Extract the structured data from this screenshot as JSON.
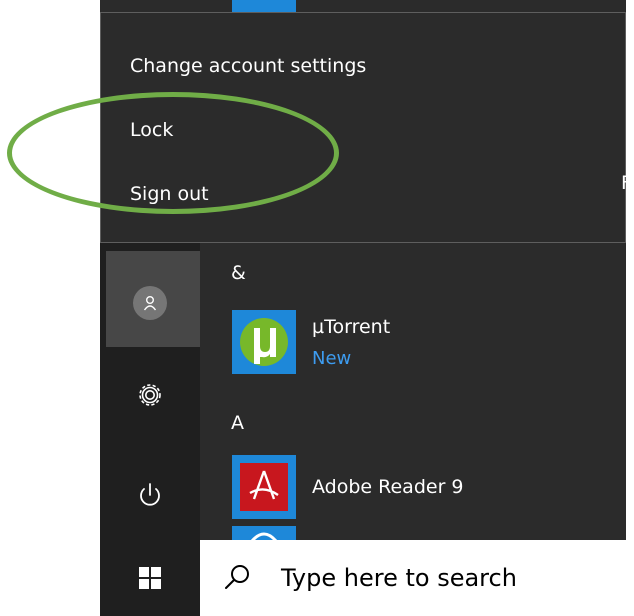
{
  "account_menu": {
    "items": [
      {
        "label": "Change account settings"
      },
      {
        "label": "Lock"
      },
      {
        "label": "Sign out"
      }
    ]
  },
  "behind_text": "F",
  "app_list": {
    "sections": [
      {
        "letter": "&",
        "apps": [
          {
            "name": "µTorrent",
            "badge": "New",
            "icon": "utorrent-icon"
          }
        ]
      },
      {
        "letter": "A",
        "apps": [
          {
            "name": "Adobe Reader 9",
            "icon": "adobe-reader-icon"
          }
        ]
      }
    ]
  },
  "rail": {
    "icons": [
      "avatar-icon",
      "gear-icon",
      "power-icon"
    ]
  },
  "taskbar": {
    "start_icon": "windows-logo-icon",
    "search": {
      "placeholder": "Type here to search",
      "icon": "search-icon"
    }
  },
  "colors": {
    "menu_bg": "#2b2b2b",
    "rail_bg": "#1f1f1f",
    "tile_blue": "#1e88d9",
    "utorrent_green": "#77b82a",
    "adobe_red": "#c8171e",
    "badge_blue": "#3d9cf0",
    "annotation_green": "#70ad47"
  }
}
